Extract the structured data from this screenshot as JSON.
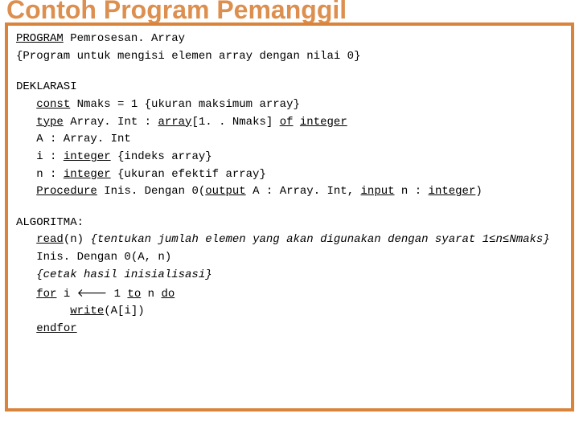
{
  "slide_title": "Contoh Program Pemanggil",
  "program_kw": "PROGRAM",
  "program_name": " Pemrosesan. Array",
  "program_comment": "{Program untuk mengisi elemen array dengan nilai 0}",
  "deklarasi_hdr": "DEKLARASI",
  "const_kw": "const",
  "const_rest": " Nmaks = 1 {ukuran maksimum array}",
  "type_kw": "type",
  "type_mid1": " Array. Int : ",
  "array_kw": "array",
  "type_mid2": "[1. . Nmaks] ",
  "of_kw": "of",
  "sp": " ",
  "integer_kw": "integer",
  "a_decl": "   A : Array. Int",
  "i_decl_pre": "   i : ",
  "i_decl_post": " {indeks array}",
  "n_decl_pre": "   n : ",
  "n_decl_post": " {ukuran efektif array}",
  "proc_kw": "Procedure",
  "proc_mid1": " Inis. Dengan 0(",
  "output_kw": "output",
  "proc_mid2": " A : Array. Int, ",
  "input_kw": "input",
  "proc_mid3": " n : ",
  "proc_end": ")",
  "algoritma_hdr": "ALGORITMA:",
  "read_kw": "read",
  "read_arg": "(n) ",
  "read_comment": "{tentukan jumlah elemen yang akan digunakan dengan syarat 1≤n≤Nmaks}",
  "call_line": "   Inis. Dengan 0(A, n)",
  "cetak_comment": "   {cetak hasil inisialisasi}",
  "for_kw": "for",
  "for_mid1": " i ",
  "arrow": "🡐",
  "for_mid2": " 1 ",
  "to_kw": "to",
  "for_mid3": " n ",
  "do_kw": "do",
  "write_kw": "write",
  "write_arg": "(A[i])",
  "endfor_kw": "endfor",
  "ind1": "   ",
  "ind2": "        "
}
